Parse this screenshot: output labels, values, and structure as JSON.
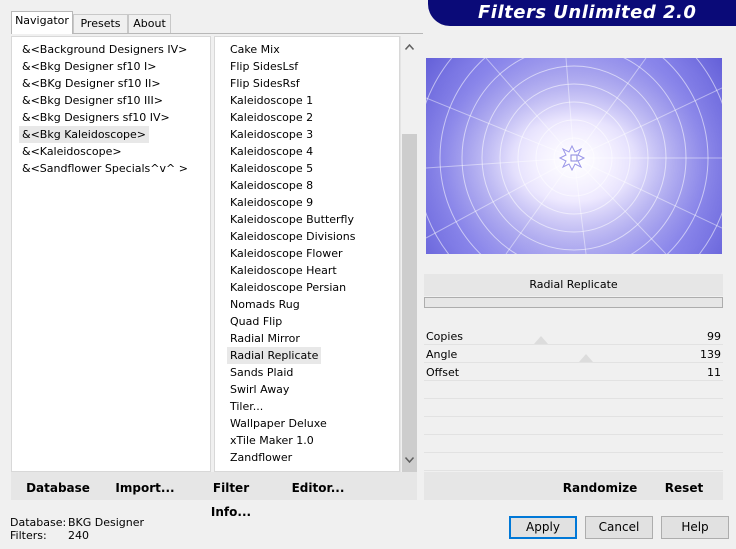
{
  "tabs": [
    {
      "label": "Navigator",
      "active": true
    },
    {
      "label": "Presets",
      "active": false
    },
    {
      "label": "About",
      "active": false
    }
  ],
  "banner": {
    "title": "Filters Unlimited 2.0",
    "color": "#0a0a78"
  },
  "categories": [
    {
      "label": "&<Background Designers IV>",
      "selected": false
    },
    {
      "label": "&<Bkg Designer sf10 I>",
      "selected": false
    },
    {
      "label": "&<BKg Designer sf10 II>",
      "selected": false
    },
    {
      "label": "&<Bkg Designer sf10 III>",
      "selected": false
    },
    {
      "label": "&<Bkg Designers sf10 IV>",
      "selected": false
    },
    {
      "label": "&<Bkg Kaleidoscope>",
      "selected": true
    },
    {
      "label": "&<Kaleidoscope>",
      "selected": false
    },
    {
      "label": "&<Sandflower Specials^v^ >",
      "selected": false
    }
  ],
  "filters": [
    {
      "label": "Cake Mix",
      "selected": false
    },
    {
      "label": "Flip SidesLsf",
      "selected": false
    },
    {
      "label": "Flip SidesRsf",
      "selected": false
    },
    {
      "label": "Kaleidoscope 1",
      "selected": false
    },
    {
      "label": "Kaleidoscope 2",
      "selected": false
    },
    {
      "label": "Kaleidoscope 3",
      "selected": false
    },
    {
      "label": "Kaleidoscope 4",
      "selected": false
    },
    {
      "label": "Kaleidoscope 5",
      "selected": false
    },
    {
      "label": "Kaleidoscope 8",
      "selected": false
    },
    {
      "label": "Kaleidoscope 9",
      "selected": false
    },
    {
      "label": "Kaleidoscope Butterfly",
      "selected": false
    },
    {
      "label": "Kaleidoscope Divisions",
      "selected": false
    },
    {
      "label": "Kaleidoscope Flower",
      "selected": false
    },
    {
      "label": "Kaleidoscope Heart",
      "selected": false
    },
    {
      "label": "Kaleidoscope Persian",
      "selected": false
    },
    {
      "label": "Nomads Rug",
      "selected": false
    },
    {
      "label": "Quad Flip",
      "selected": false
    },
    {
      "label": "Radial Mirror",
      "selected": false
    },
    {
      "label": "Radial Replicate",
      "selected": true
    },
    {
      "label": "Sands Plaid",
      "selected": false
    },
    {
      "label": "Swirl Away",
      "selected": false
    },
    {
      "label": "Tiler...",
      "selected": false
    },
    {
      "label": "Wallpaper Deluxe",
      "selected": false
    },
    {
      "label": "xTile Maker 1.0",
      "selected": false
    },
    {
      "label": "Zandflower",
      "selected": false
    }
  ],
  "scrollbar": {
    "up_icon": "chevron-up-icon",
    "down_icon": "chevron-down-icon"
  },
  "preview": {
    "filter_name": "Radial Replicate"
  },
  "params": [
    {
      "label": "Copies",
      "value": "99"
    },
    {
      "label": "Angle",
      "value": "139"
    },
    {
      "label": "Offset",
      "value": "11"
    }
  ],
  "toolbar": {
    "database": "Database",
    "import": "Import...",
    "filter_info": "Filter Info...",
    "editor": "Editor...",
    "randomize": "Randomize",
    "reset": "Reset"
  },
  "status": {
    "database_label": "Database:",
    "database_value": "BKG Designer",
    "filters_label": "Filters:",
    "filters_value": "240"
  },
  "buttons": {
    "apply": "Apply",
    "cancel": "Cancel",
    "help": "Help"
  }
}
